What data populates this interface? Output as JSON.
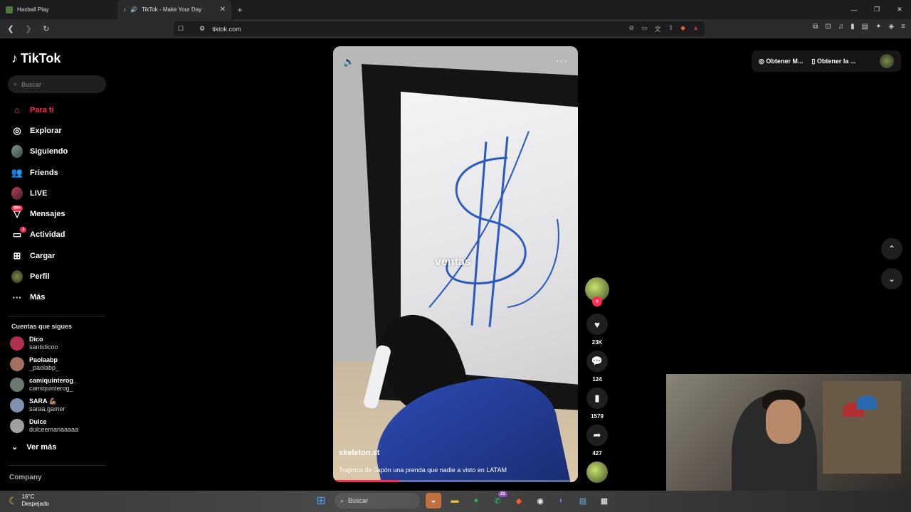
{
  "browser": {
    "tabs": [
      {
        "title": "Haxball Play",
        "active": false
      },
      {
        "title": "TikTok - Make Your Day",
        "active": true
      }
    ],
    "url": "tiktok.com"
  },
  "sidebar": {
    "logo": "TikTok",
    "search_placeholder": "Buscar",
    "nav": [
      {
        "label": "Para ti",
        "icon": "home-icon",
        "active": true
      },
      {
        "label": "Explorar",
        "icon": "compass-icon"
      },
      {
        "label": "Siguiendo",
        "icon": "avatar-icon"
      },
      {
        "label": "Friends",
        "icon": "friends-icon"
      },
      {
        "label": "LIVE",
        "icon": "live-icon"
      },
      {
        "label": "Mensajes",
        "icon": "messages-icon",
        "badge": "99+"
      },
      {
        "label": "Actividad",
        "icon": "activity-icon",
        "badge": "1"
      },
      {
        "label": "Cargar",
        "icon": "upload-icon"
      },
      {
        "label": "Perfil",
        "icon": "profile-icon"
      },
      {
        "label": "Más",
        "icon": "more-icon"
      }
    ],
    "following_title": "Cuentas que sigues",
    "following": [
      {
        "name": "Dico",
        "username": "santidicoo",
        "color": "#b03050"
      },
      {
        "name": "Paolaabp",
        "username": "_paolabp_",
        "color": "#a07060"
      },
      {
        "name": "camiquinterog_",
        "username": "camiquinterog_",
        "color": "#6a7a70"
      },
      {
        "name": "SARA 💪🏽",
        "username": "saraa.gamer",
        "color": "#8090b0"
      },
      {
        "name": "Dulce",
        "username": "dulceemariaaaaa",
        "color": "#a0a0a0"
      }
    ],
    "see_more": "Ver más",
    "company": "Company"
  },
  "video": {
    "overlay_text": "ventas",
    "author": "skeleton.st",
    "caption": "Trajimos de Japón una prenda que nadie a visto en LATAM",
    "progress": 0.27
  },
  "actions": {
    "likes": "23K",
    "comments": "124",
    "saves": "1579",
    "shares": "427"
  },
  "topright": {
    "btn1": "Obtener M...",
    "btn2": "Obtener la ..."
  },
  "taskbar": {
    "temperature": "16°C",
    "weather": "Despejado",
    "search": "Buscar",
    "notif": "21"
  }
}
